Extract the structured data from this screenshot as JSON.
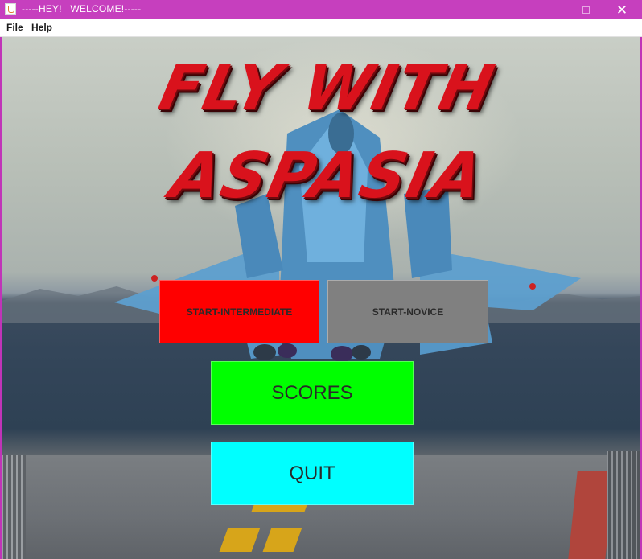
{
  "window": {
    "title": "-----HEY!   WELCOME!-----",
    "app_icon": "java-cup-icon",
    "controls": {
      "minimize_icon": "minimize-icon",
      "maximize_icon": "maximize-icon",
      "close_icon": "close-icon",
      "close_glyph": "✕"
    }
  },
  "menubar": {
    "items": [
      {
        "label": "File"
      },
      {
        "label": "Help"
      }
    ]
  },
  "main": {
    "logo": {
      "line1": "FLY WITH",
      "line2": "ASPASIA"
    },
    "buttons": {
      "intermediate": {
        "label": "START-INTERMEDIATE",
        "color": "#ff0000"
      },
      "novice": {
        "label": "START-NOVICE",
        "color": "#808080"
      },
      "scores": {
        "label": "SCORES",
        "color": "#00ff00"
      },
      "quit": {
        "label": "QUIT",
        "color": "#00ffff"
      }
    }
  },
  "colors": {
    "titlebar": "#c63fbe",
    "logo_red": "#d9121c"
  }
}
